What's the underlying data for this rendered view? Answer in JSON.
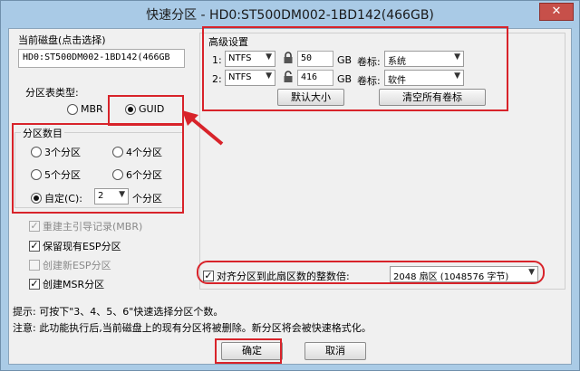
{
  "window": {
    "title": "快速分区 - HD0:ST500DM002-1BD142(466GB)",
    "close_glyph": "✕"
  },
  "disk": {
    "label": "当前磁盘(点击选择)",
    "value": "HD0:ST500DM002-1BD142(466GB"
  },
  "table_type": {
    "label": "分区表类型:",
    "mbr": "MBR",
    "guid": "GUID",
    "selected": "GUID"
  },
  "partition_count": {
    "label": "分区数目",
    "opt3": "3个分区",
    "opt4": "4个分区",
    "opt5": "5个分区",
    "opt6": "6个分区",
    "custom": "自定(C):",
    "custom_value": "2",
    "custom_suffix": "个分区",
    "selected": "custom"
  },
  "options": {
    "rebuild_mbr": "重建主引导记录(MBR)",
    "keep_esp": "保留现有ESP分区",
    "create_esp": "创建新ESP分区",
    "create_msr": "创建MSR分区"
  },
  "advanced": {
    "label": "高级设置",
    "rows": [
      {
        "index": "1:",
        "fs": "NTFS",
        "size": "50",
        "unit": "GB",
        "vol_label": "卷标:",
        "volume": "系统",
        "icon": "lock-icon"
      },
      {
        "index": "2:",
        "fs": "NTFS",
        "size": "416",
        "unit": "GB",
        "vol_label": "卷标:",
        "volume": "软件",
        "icon": "unlock-icon"
      }
    ],
    "default_size_btn": "默认大小",
    "clear_labels_btn": "清空所有卷标"
  },
  "align": {
    "label": "对齐分区到此扇区数的整数倍:",
    "value": "2048 扇区 (1048576 字节)"
  },
  "hints": {
    "hint1": "提示: 可按下\"3、4、5、6\"快速选择分区个数。",
    "hint2": "注意: 此功能执行后,当前磁盘上的现有分区将被删除。新分区将会被快速格式化。"
  },
  "buttons": {
    "ok": "确定",
    "cancel": "取消"
  },
  "colors": {
    "annotation_red": "#d8232a",
    "window_frame": "#aacbe6",
    "dialog_bg": "#f0f0f0"
  }
}
